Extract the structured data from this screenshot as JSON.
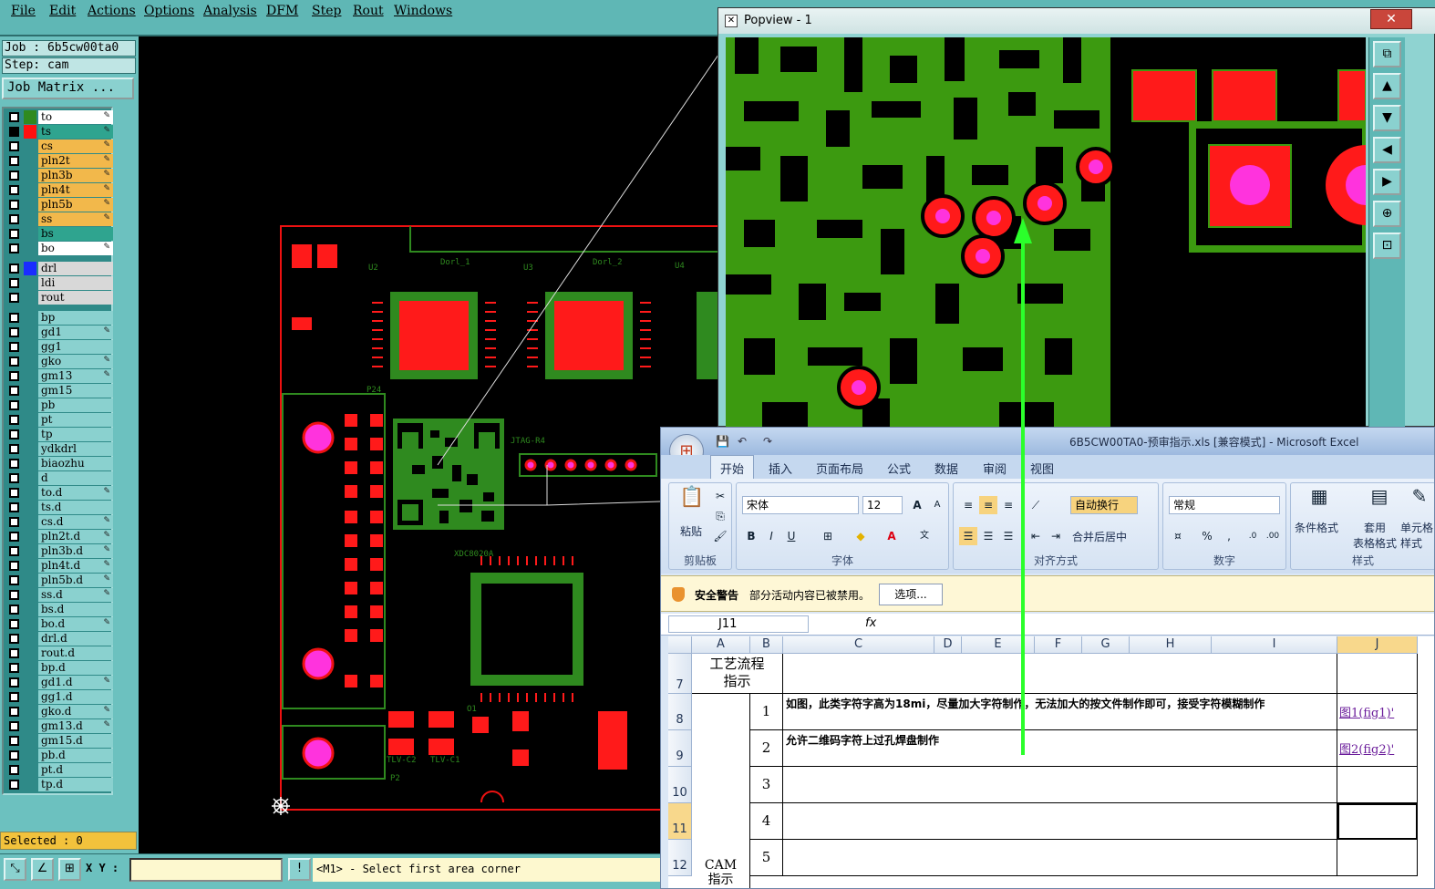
{
  "menu": [
    "File",
    "Edit",
    "Actions",
    "Options",
    "Analysis",
    "DFM",
    "Step",
    "Rout",
    "Windows"
  ],
  "job": {
    "job_label": "Job : 6b5cw00ta0",
    "step_label": "Step: cam",
    "matrix_button": "Job Matrix ..."
  },
  "layers": [
    {
      "name": "to",
      "color": "#ffffff",
      "swatch": "#2f8a1f",
      "edit": true
    },
    {
      "name": "ts",
      "color": "#2fa48f",
      "swatch": "#ff1010",
      "edit": true,
      "active": true
    },
    {
      "name": "cs",
      "color": "#f2b84b",
      "swatch": "",
      "edit": true
    },
    {
      "name": "pln2t",
      "color": "#f2b84b",
      "swatch": "",
      "edit": true
    },
    {
      "name": "pln3b",
      "color": "#f2b84b",
      "swatch": "",
      "edit": true
    },
    {
      "name": "pln4t",
      "color": "#f2b84b",
      "swatch": "",
      "edit": true
    },
    {
      "name": "pln5b",
      "color": "#f2b84b",
      "swatch": "",
      "edit": true
    },
    {
      "name": "ss",
      "color": "#f2b84b",
      "swatch": "",
      "edit": true
    },
    {
      "name": "bs",
      "color": "#2fa48f",
      "swatch": "",
      "edit": false
    },
    {
      "name": "bo",
      "color": "#ffffff",
      "swatch": "",
      "edit": true
    },
    {
      "name": "drl",
      "color": "#d8d8d8",
      "swatch": "#1a2cff",
      "edit": false
    },
    {
      "name": "ldi",
      "color": "#d8d8d8",
      "swatch": "",
      "edit": false
    },
    {
      "name": "rout",
      "color": "#d8d8d8",
      "swatch": "",
      "edit": false
    },
    {
      "name": "bp",
      "color": "#8ad1cf",
      "swatch": "",
      "edit": false
    },
    {
      "name": "gd1",
      "color": "#8ad1cf",
      "swatch": "",
      "edit": true
    },
    {
      "name": "gg1",
      "color": "#8ad1cf",
      "swatch": "",
      "edit": false
    },
    {
      "name": "gko",
      "color": "#8ad1cf",
      "swatch": "",
      "edit": true
    },
    {
      "name": "gm13",
      "color": "#8ad1cf",
      "swatch": "",
      "edit": true
    },
    {
      "name": "gm15",
      "color": "#8ad1cf",
      "swatch": "",
      "edit": false
    },
    {
      "name": "pb",
      "color": "#8ad1cf",
      "swatch": "",
      "edit": false
    },
    {
      "name": "pt",
      "color": "#8ad1cf",
      "swatch": "",
      "edit": false
    },
    {
      "name": "tp",
      "color": "#8ad1cf",
      "swatch": "",
      "edit": false
    },
    {
      "name": "ydkdrl",
      "color": "#8ad1cf",
      "swatch": "",
      "edit": false
    },
    {
      "name": "biaozhu",
      "color": "#8ad1cf",
      "swatch": "",
      "edit": false
    },
    {
      "name": "d",
      "color": "#8ad1cf",
      "swatch": "",
      "edit": false
    },
    {
      "name": "to.d",
      "color": "#8ad1cf",
      "swatch": "",
      "edit": true
    },
    {
      "name": "ts.d",
      "color": "#8ad1cf",
      "swatch": "",
      "edit": false
    },
    {
      "name": "cs.d",
      "color": "#8ad1cf",
      "swatch": "",
      "edit": true
    },
    {
      "name": "pln2t.d",
      "color": "#8ad1cf",
      "swatch": "",
      "edit": true
    },
    {
      "name": "pln3b.d",
      "color": "#8ad1cf",
      "swatch": "",
      "edit": true
    },
    {
      "name": "pln4t.d",
      "color": "#8ad1cf",
      "swatch": "",
      "edit": true
    },
    {
      "name": "pln5b.d",
      "color": "#8ad1cf",
      "swatch": "",
      "edit": true
    },
    {
      "name": "ss.d",
      "color": "#8ad1cf",
      "swatch": "",
      "edit": true
    },
    {
      "name": "bs.d",
      "color": "#8ad1cf",
      "swatch": "",
      "edit": false
    },
    {
      "name": "bo.d",
      "color": "#8ad1cf",
      "swatch": "",
      "edit": true
    },
    {
      "name": "drl.d",
      "color": "#8ad1cf",
      "swatch": "",
      "edit": false
    },
    {
      "name": "rout.d",
      "color": "#8ad1cf",
      "swatch": "",
      "edit": false
    },
    {
      "name": "bp.d",
      "color": "#8ad1cf",
      "swatch": "",
      "edit": false
    },
    {
      "name": "gd1.d",
      "color": "#8ad1cf",
      "swatch": "",
      "edit": true
    },
    {
      "name": "gg1.d",
      "color": "#8ad1cf",
      "swatch": "",
      "edit": false
    },
    {
      "name": "gko.d",
      "color": "#8ad1cf",
      "swatch": "",
      "edit": true
    },
    {
      "name": "gm13.d",
      "color": "#8ad1cf",
      "swatch": "",
      "edit": true
    },
    {
      "name": "gm15.d",
      "color": "#8ad1cf",
      "swatch": "",
      "edit": false
    },
    {
      "name": "pb.d",
      "color": "#8ad1cf",
      "swatch": "",
      "edit": false
    },
    {
      "name": "pt.d",
      "color": "#8ad1cf",
      "swatch": "",
      "edit": false
    },
    {
      "name": "tp.d",
      "color": "#8ad1cf",
      "swatch": "",
      "edit": false
    }
  ],
  "status": {
    "selected": "Selected : 0",
    "xy_label": "X Y :",
    "xy_value": "",
    "message": "<M1> - Select first area corner"
  },
  "pcb_labels": [
    "P24",
    "P2",
    "U2",
    "U3",
    "U4",
    "O1",
    "Dorl_1",
    "Dorl_2",
    "JTAG-R4",
    "TLV-C2",
    "TLV-C1",
    "XDC8020A"
  ],
  "popview": {
    "title": "Popview - 1"
  },
  "excel": {
    "title": "6B5CW00TA0-预审指示.xls  [兼容模式] - Microsoft Excel",
    "tabs": [
      "开始",
      "插入",
      "页面布局",
      "公式",
      "数据",
      "审阅",
      "视图"
    ],
    "groups": [
      "剪贴板",
      "字体",
      "对齐方式",
      "数字",
      "样式"
    ],
    "paste": "粘贴",
    "font_name": "宋体",
    "font_size": "12",
    "wrap": "自动换行",
    "merge": "合并后居中",
    "number_format": "常规",
    "cond_format": "条件格式",
    "table_format": "套用\n表格格式",
    "cell_style": "单元格\n样式",
    "security_title": "安全警告",
    "security_text": "部分活动内容已被禁用。",
    "options_button": "选项...",
    "namebox": "J11",
    "columns": [
      "A",
      "B",
      "C",
      "D",
      "E",
      "F",
      "G",
      "H",
      "I",
      "J"
    ],
    "rows": [
      "7",
      "8",
      "9",
      "10",
      "11",
      "12"
    ],
    "header_cell": "工艺流程\n指示",
    "cam_cell": "CAM\n指示",
    "items": [
      {
        "no": "1",
        "text": "如图，此类字符字高为18mi，尽量加大字符制作，无法加大的按文件制作即可，接受字符模糊制作",
        "link": "图1(fig1)'"
      },
      {
        "no": "2",
        "text": "允许二维码字符上过孔焊盘制作",
        "link": "图2(fig2)'"
      },
      {
        "no": "3",
        "text": "",
        "link": ""
      },
      {
        "no": "4",
        "text": "",
        "link": ""
      },
      {
        "no": "5",
        "text": "",
        "link": ""
      }
    ]
  }
}
